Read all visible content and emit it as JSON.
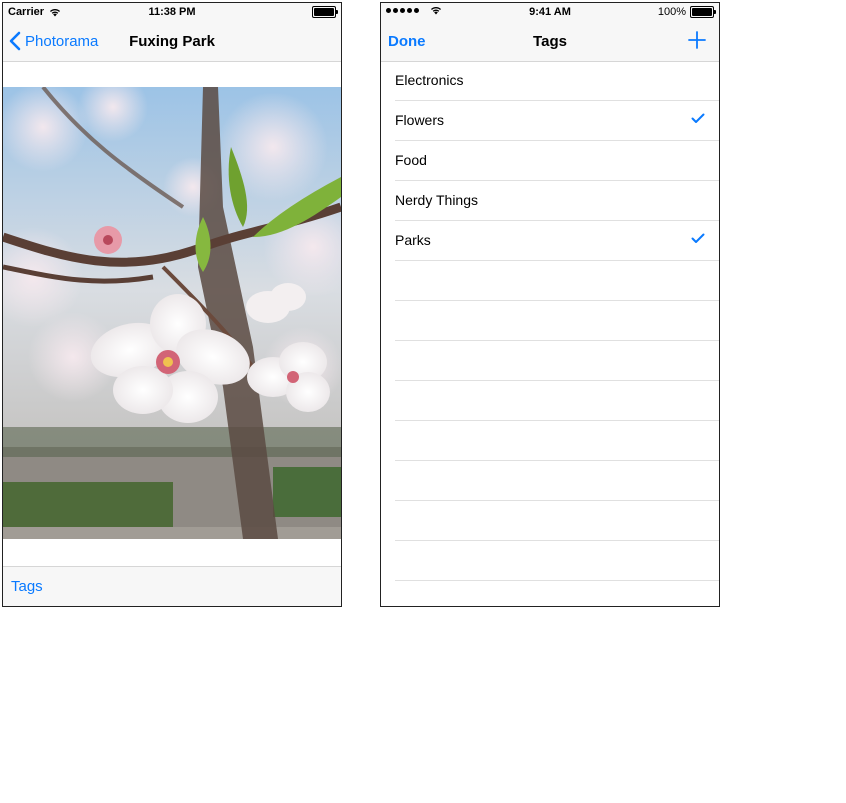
{
  "left": {
    "status": {
      "carrier": "Carrier",
      "time": "11:38 PM"
    },
    "nav": {
      "back_label": "Photorama",
      "title": "Fuxing Park"
    },
    "toolbar": {
      "tags_label": "Tags"
    }
  },
  "right": {
    "status": {
      "time": "9:41 AM",
      "battery": "100%"
    },
    "nav": {
      "done_label": "Done",
      "title": "Tags"
    },
    "tags": [
      {
        "label": "Electronics",
        "checked": false
      },
      {
        "label": "Flowers",
        "checked": true
      },
      {
        "label": "Food",
        "checked": false
      },
      {
        "label": "Nerdy Things",
        "checked": false
      },
      {
        "label": "Parks",
        "checked": true
      }
    ]
  },
  "colors": {
    "tint": "#0a7aff",
    "bar": "#f7f7f7"
  }
}
